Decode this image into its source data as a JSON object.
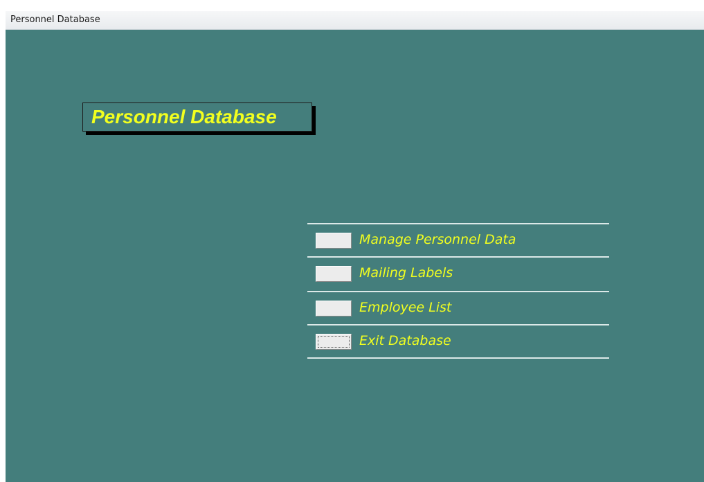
{
  "window": {
    "title": "Personnel Database"
  },
  "form": {
    "heading": "Personnel Database",
    "menu_items": [
      {
        "label": "Manage Personnel Data"
      },
      {
        "label": "Mailing Labels"
      },
      {
        "label": "Employee List"
      },
      {
        "label": "Exit Database"
      }
    ]
  },
  "colors": {
    "background": "#447e7c",
    "label_text": "#f2ff1f",
    "button_face": "#ececec"
  }
}
